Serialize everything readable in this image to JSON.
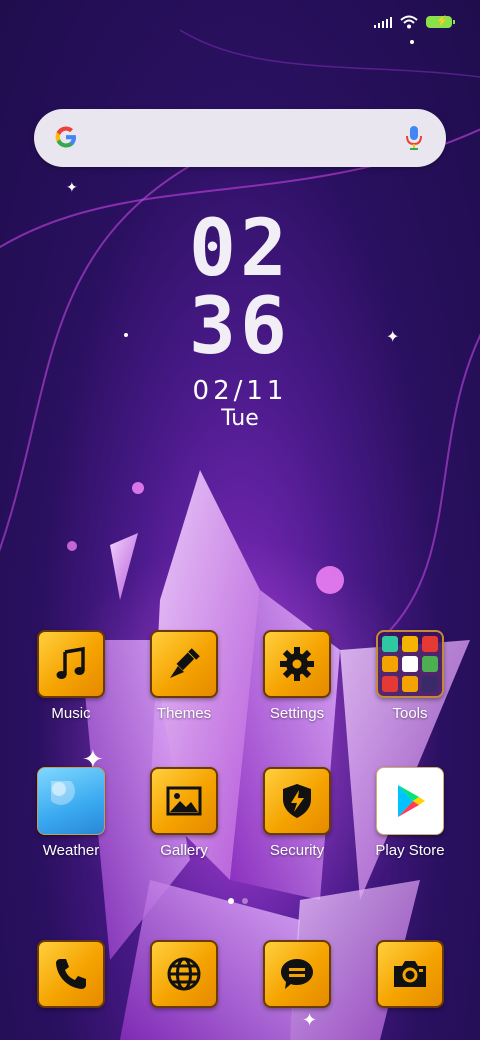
{
  "clock": {
    "hours": "02",
    "minutes": "36",
    "date": "02/11",
    "day": "Tue"
  },
  "search": {
    "logo_icon": "google-g-icon",
    "mic_icon": "mic-icon"
  },
  "apps": [
    {
      "label": "Music",
      "icon": "music-note-icon"
    },
    {
      "label": "Themes",
      "icon": "paintbrush-icon"
    },
    {
      "label": "Settings",
      "icon": "gear-icon"
    },
    {
      "label": "Tools",
      "icon": "folder-icon"
    },
    {
      "label": "Weather",
      "icon": "weather-icon"
    },
    {
      "label": "Gallery",
      "icon": "image-icon"
    },
    {
      "label": "Security",
      "icon": "shield-bolt-icon"
    },
    {
      "label": "Play Store",
      "icon": "play-store-icon"
    }
  ],
  "dock": [
    {
      "icon": "phone-icon"
    },
    {
      "icon": "globe-icon"
    },
    {
      "icon": "message-icon"
    },
    {
      "icon": "camera-icon"
    }
  ],
  "page_indicator": {
    "pages": 2,
    "current": 1
  },
  "colors": {
    "icon_gold": "#f5a300",
    "background": "#2a1060",
    "crystal": "#d9a6f0"
  }
}
